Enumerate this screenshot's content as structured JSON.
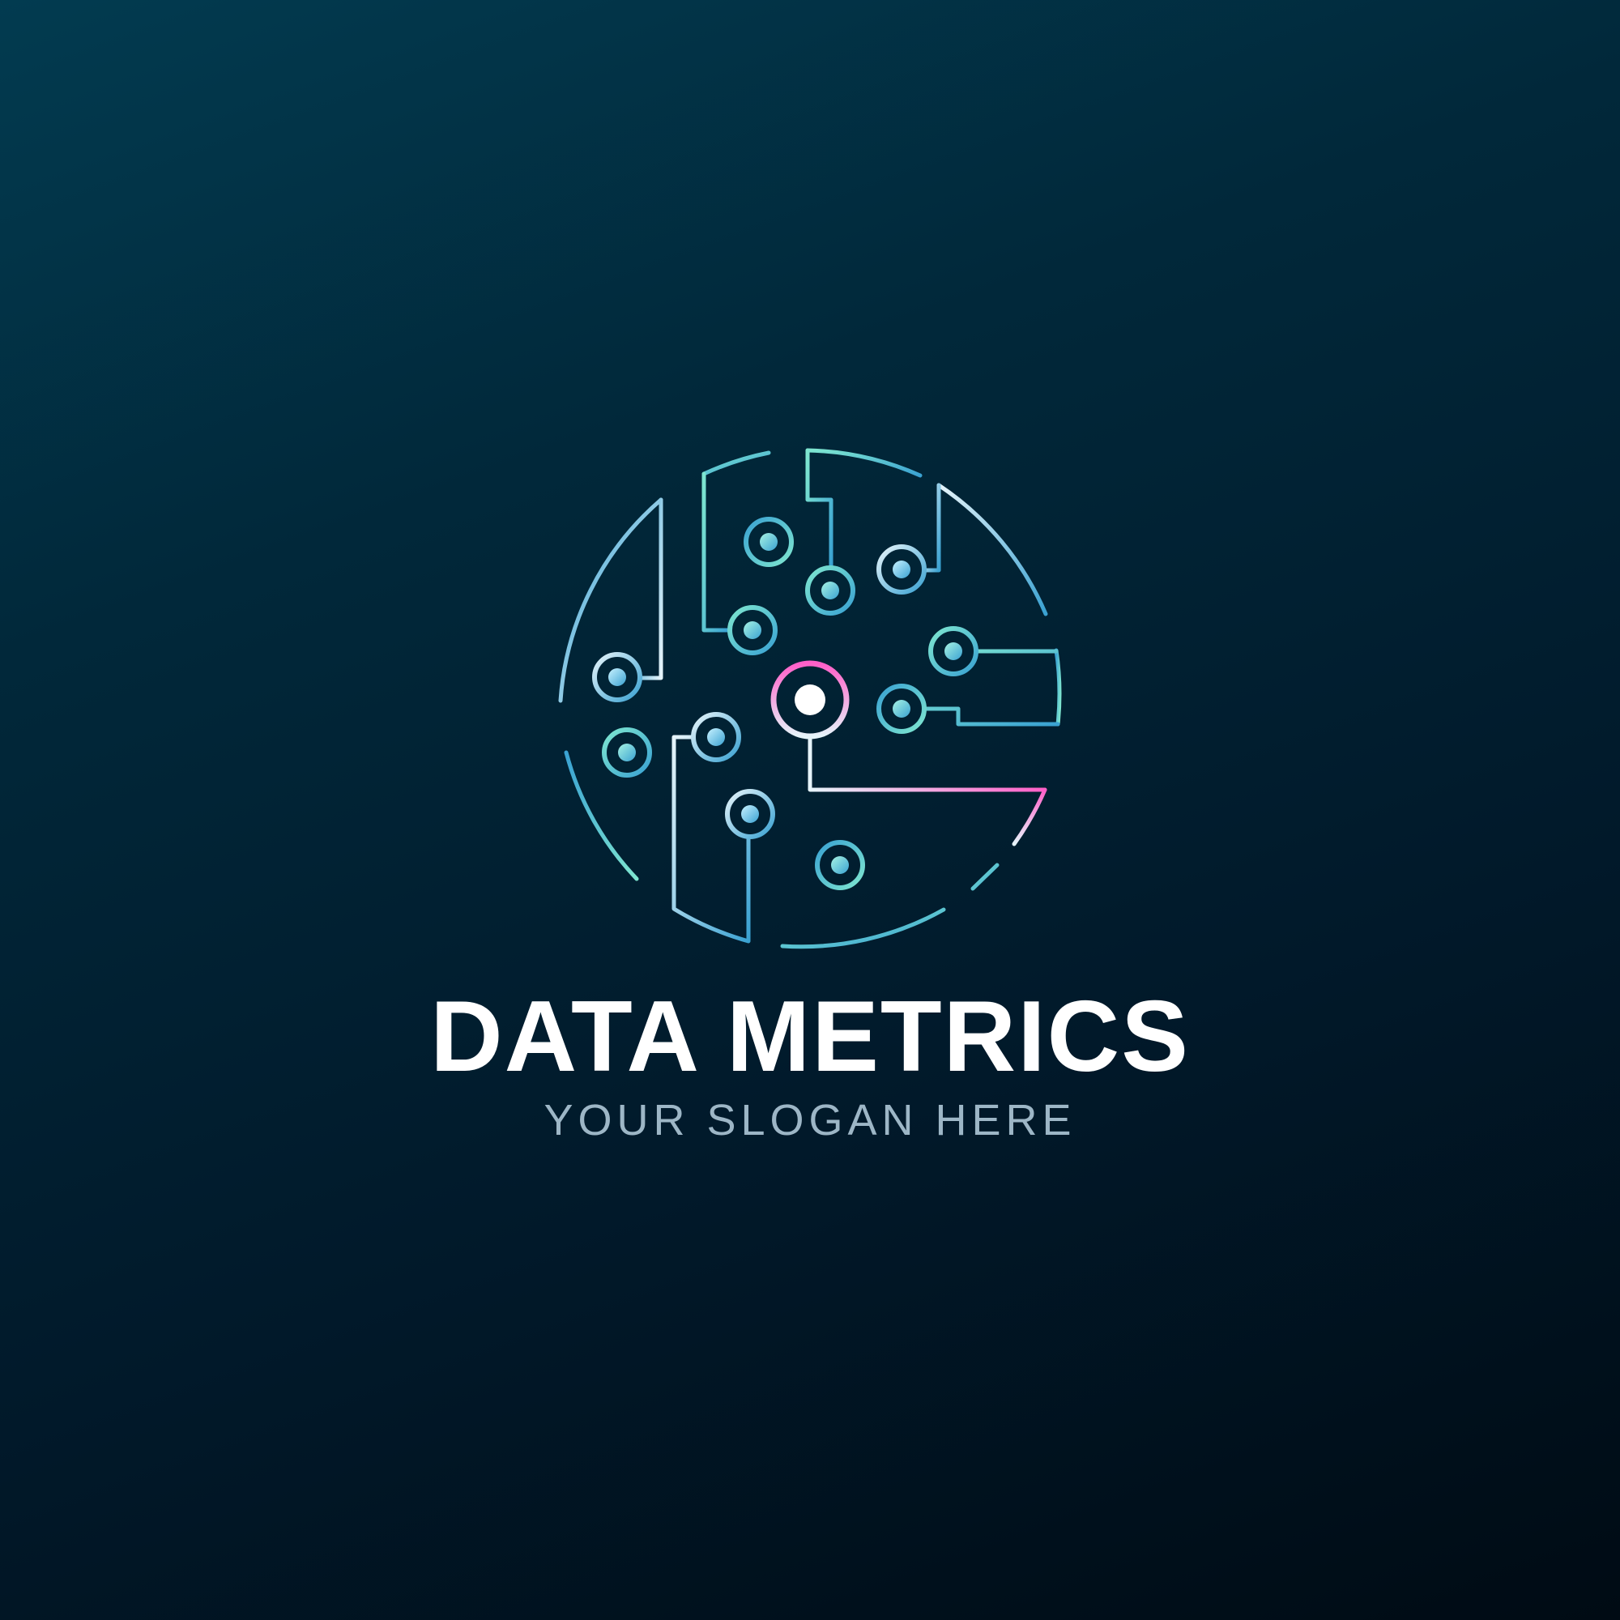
{
  "logo": {
    "brand_name": "DATA METRICS",
    "slogan": "YOUR SLOGAN HERE",
    "icon": "circuit-globe-icon"
  },
  "colors": {
    "background_top": "#023b50",
    "background_bottom": "#000b14",
    "brand_text": "#ffffff",
    "slogan_text": "#9db6c6",
    "line_teal": "#7ee6d0",
    "line_blue": "#3aa2d2",
    "line_white": "#e6f4fa",
    "accent_pink": "#ff5fc8"
  }
}
